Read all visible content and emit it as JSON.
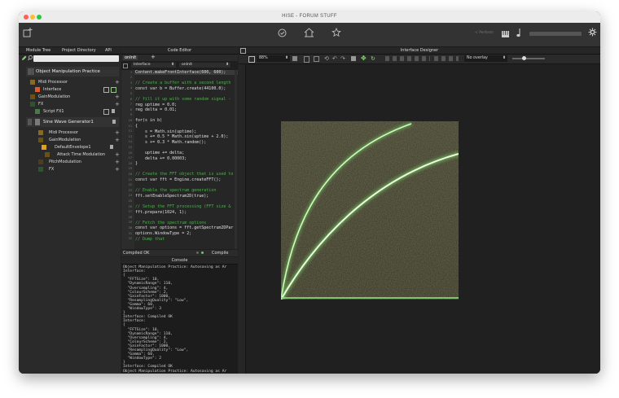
{
  "window": {
    "title": "HISE - FORUM STUFF",
    "traffic_colors": [
      "#ff5f57",
      "#febc2e",
      "#28c840"
    ]
  },
  "toolbar": {
    "left_icon": "add-window-icon",
    "center_icons": [
      "compile-icon",
      "home-icon",
      "star-icon"
    ],
    "right_icons": [
      "perfmeter-icon",
      "keyboard-icon",
      "note-icon",
      "settings-icon"
    ],
    "perf_label": "< Perform"
  },
  "module_tree": {
    "tabs": [
      "Module Tree",
      "Project Directory",
      "API"
    ],
    "search_placeholder": "",
    "items": [
      {
        "label": "Object Manipulation Practice",
        "color": "#7a7a7a",
        "level": 0
      },
      {
        "label": "Midi Processor",
        "color": "#b07f2a",
        "level": 1
      },
      {
        "label": "Interface",
        "color": "#e05a2a",
        "level": 2
      },
      {
        "label": "GainModulation",
        "color": "#8a6a1a",
        "level": 1
      },
      {
        "label": "FX",
        "color": "#3a6a3a",
        "level": 1
      },
      {
        "label": "Script FX1",
        "color": "#4a7a4a",
        "level": 2
      },
      {
        "label": "Sine Wave Generator1",
        "color": "#7a7a7a",
        "level": 0
      },
      {
        "label": "Midi Processor",
        "color": "#b07f2a",
        "level": 1
      },
      {
        "label": "GainModulation",
        "color": "#8a6a1a",
        "level": 1
      },
      {
        "label": "DefaultEnvelope1",
        "color": "#e0a020",
        "level": 2
      },
      {
        "label": "Attack Time Modulation",
        "color": "#8a6a1a",
        "level": 3
      },
      {
        "label": "PitchModulation",
        "color": "#5a4a2a",
        "level": 1
      },
      {
        "label": "FX",
        "color": "#3a6a3a",
        "level": 1
      }
    ]
  },
  "code_editor": {
    "header": "Code Editor",
    "file_tab": "onInit",
    "processor_select": "Interface",
    "callback_select": "onInit",
    "lines": [
      {
        "n": "1",
        "parts": [
          [
            "t",
            "Content.makeFrontInterface(600, 600);"
          ]
        ]
      },
      {
        "n": "2",
        "parts": [
          [
            "t",
            ""
          ]
        ]
      },
      {
        "n": "3",
        "parts": [
          [
            "c",
            "// Create a buffer with a second length"
          ]
        ]
      },
      {
        "n": "4",
        "parts": [
          [
            "t",
            "const var b = Buffer.create(44100.0);"
          ]
        ]
      },
      {
        "n": "5",
        "parts": [
          [
            "t",
            ""
          ]
        ]
      },
      {
        "n": "6",
        "parts": [
          [
            "c",
            "// fill it up with some random signal -"
          ]
        ]
      },
      {
        "n": "7",
        "parts": [
          [
            "t",
            "reg uptime = 0.0;"
          ]
        ]
      },
      {
        "n": "8",
        "parts": [
          [
            "t",
            "reg delta = 0.01;"
          ]
        ]
      },
      {
        "n": "9",
        "parts": [
          [
            "t",
            ""
          ]
        ]
      },
      {
        "n": "10",
        "parts": [
          [
            "t",
            "for(s in b)"
          ]
        ]
      },
      {
        "n": "11",
        "parts": [
          [
            "t",
            "{"
          ]
        ]
      },
      {
        "n": "12",
        "parts": [
          [
            "t",
            "    s = Math.sin(uptime);"
          ]
        ]
      },
      {
        "n": "13",
        "parts": [
          [
            "t",
            "    s += 0.5 * Math.sin(uptime + 2.0);"
          ]
        ]
      },
      {
        "n": "14",
        "parts": [
          [
            "t",
            "    s += 0.3 * Math.random();"
          ]
        ]
      },
      {
        "n": "15",
        "parts": [
          [
            "t",
            ""
          ]
        ]
      },
      {
        "n": "16",
        "parts": [
          [
            "t",
            "    uptime += delta;"
          ]
        ]
      },
      {
        "n": "17",
        "parts": [
          [
            "t",
            "    delta += 0.00003;"
          ]
        ]
      },
      {
        "n": "18",
        "parts": [
          [
            "t",
            "}"
          ]
        ]
      },
      {
        "n": "19",
        "parts": [
          [
            "t",
            ""
          ]
        ]
      },
      {
        "n": "20",
        "parts": [
          [
            "c",
            "// Create the FFT object that is used to"
          ]
        ]
      },
      {
        "n": "21",
        "parts": [
          [
            "t",
            "const var fft = Engine.createFFT();"
          ]
        ]
      },
      {
        "n": "22",
        "parts": [
          [
            "t",
            ""
          ]
        ]
      },
      {
        "n": "23",
        "parts": [
          [
            "c",
            "// Enable the spectrum generation"
          ]
        ]
      },
      {
        "n": "24",
        "parts": [
          [
            "t",
            "fft.setEnableSpectrum2D(true);"
          ]
        ]
      },
      {
        "n": "25",
        "parts": [
          [
            "t",
            ""
          ]
        ]
      },
      {
        "n": "26",
        "parts": [
          [
            "c",
            "// Setup the FFT processing (FFT size &"
          ]
        ]
      },
      {
        "n": "27",
        "parts": [
          [
            "t",
            "fft.prepare(1024, 1);"
          ]
        ]
      },
      {
        "n": "28",
        "parts": [
          [
            "t",
            ""
          ]
        ]
      },
      {
        "n": "29",
        "parts": [
          [
            "c",
            "// Fetch the spectrum options"
          ]
        ]
      },
      {
        "n": "30",
        "parts": [
          [
            "t",
            "const var options = fft.getSpectrum2DPar"
          ]
        ]
      },
      {
        "n": "31",
        "parts": [
          [
            "t",
            "options.WindowType = 2;"
          ]
        ]
      },
      {
        "n": "32",
        "parts": [
          [
            "c",
            "// Dump that"
          ]
        ]
      }
    ],
    "status": "Compiled OK",
    "compile_label": "Compile"
  },
  "console": {
    "header": "Console",
    "lines": [
      "Object Manipulation Practice: Autosaving as Ar",
      "Interface:",
      "{",
      "  \"FFTSize\": 10,",
      "  \"DynamicRange\": 110,",
      "  \"Oversampling\": 4,",
      "  \"ColourScheme\": 2,",
      "  \"GainFactor\": 1000,",
      "  \"ResamplingQuality\": \"Low\",",
      "  \"Gamma\": 60,",
      "  \"WindowType\": 3",
      "}",
      "Interface: Compiled OK",
      "Interface:",
      "{",
      "  \"FFTSize\": 10,",
      "  \"DynamicRange\": 110,",
      "  \"Oversampling\": 4,",
      "  \"ColourScheme\": 2,",
      "  \"GainFactor\": 1000,",
      "  \"ResamplingQuality\": \"Low\",",
      "  \"Gamma\": 60,",
      "  \"WindowType\": 2",
      "}",
      "Interface: Compiled OK",
      "Object Manipulation Practice: Autosaving as Ar"
    ]
  },
  "designer": {
    "header": "Interface Designer",
    "zoom": "88%",
    "overlay": "No overlay",
    "accent": "#8be07a"
  }
}
